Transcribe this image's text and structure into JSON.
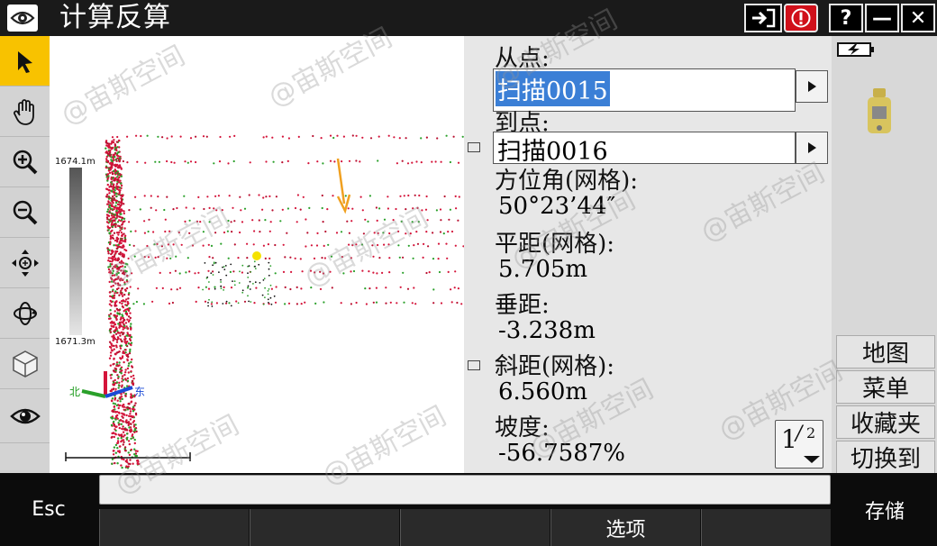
{
  "window": {
    "title": "计算反算",
    "help_label": "?",
    "minimize_label": "—",
    "close_label": "✕"
  },
  "left_toolbar": [
    {
      "name": "select-arrow-icon",
      "active": true
    },
    {
      "name": "pan-hand-icon",
      "active": false
    },
    {
      "name": "zoom-in-icon",
      "active": false
    },
    {
      "name": "zoom-out-icon",
      "active": false
    },
    {
      "name": "zoom-extents-icon",
      "active": false
    },
    {
      "name": "orbit-icon",
      "active": false
    },
    {
      "name": "view-cube-icon",
      "active": false
    },
    {
      "name": "eye-icon",
      "active": false
    }
  ],
  "map": {
    "scale_top": "1674.1m",
    "scale_bottom": "1671.3m",
    "axis_north": "北",
    "axis_east": "东"
  },
  "panel": {
    "from_label": "从点:",
    "from_value": "扫描0015",
    "to_label": "到点:",
    "to_value": "扫描0016",
    "azimuth_label": "方位角(网格):",
    "azimuth_value": "50°23’44″",
    "hdist_label": "平距(网格):",
    "hdist_value": "5.705m",
    "vdist_label": "垂距:",
    "vdist_value": "-3.238m",
    "sdist_label": "斜距(网格):",
    "sdist_value": "6.560m",
    "grade_label": "坡度:",
    "grade_value": "-56.7587%",
    "page_current": "1",
    "page_total": "2"
  },
  "side_buttons": {
    "map": "地图",
    "menu": "菜单",
    "favorites": "收藏夹",
    "switch_to": "切换到"
  },
  "bottom": {
    "esc": "Esc",
    "options": "选项",
    "store": "存储",
    "message": ""
  },
  "watermark": "@宙斯空间",
  "colors": {
    "accent_yellow": "#f8c200",
    "selection_blue": "#3b7fd6",
    "alert_red": "#d0101a"
  }
}
